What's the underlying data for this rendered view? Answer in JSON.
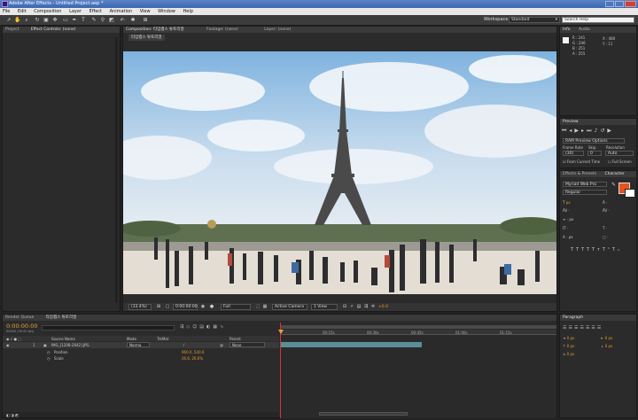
{
  "window": {
    "title": "Adobe After Effects - Untitled Project.aep *"
  },
  "menu": [
    "File",
    "Edit",
    "Composition",
    "Layer",
    "Effect",
    "Animation",
    "View",
    "Window",
    "Help"
  ],
  "toolbar": {
    "tools": [
      "selection-tool",
      "hand-tool",
      "zoom-tool",
      "rotate-tool",
      "camera-tool",
      "pan-behind-tool",
      "mask-tool",
      "pen-tool",
      "type-tool",
      "brush-tool",
      "clone-tool",
      "eraser-tool",
      "roto-brush-tool",
      "puppet-tool"
    ],
    "workspace_label": "Workspace:",
    "workspace_value": "Standard",
    "search_placeholder": "Search Help"
  },
  "project_panel": {
    "tab_project": "Project",
    "tab_effects": "Effect Controls: (none)"
  },
  "composition_panel": {
    "tab": "Composition: 타임랩스 튜토리얼",
    "tab_footage": "Footage: (none)",
    "tab_layer": "Layer: (none)",
    "comp_name": "타임랩스 튜토리얼",
    "zoom": "(33.4%)",
    "timecode": "0:00:00:00",
    "resolution": "Full",
    "camera": "Active Camera",
    "view": "1 View",
    "exposure": "+0.0"
  },
  "info_panel": {
    "tab": "Info",
    "tab_audio": "Audio",
    "r": "R : 241",
    "g": "G : 246",
    "b": "B : 251",
    "a": "A : 255",
    "x": "X : 480",
    "y": "Y : 11"
  },
  "preview_panel": {
    "tab": "Preview",
    "options": "RAM Preview Options",
    "frame_rate_label": "Frame Rate",
    "skip_label": "Skip",
    "resolution_label": "Resolution",
    "frame_rate": "(30)",
    "skip": "0",
    "resolution": "Auto",
    "from_current": "From Current Time",
    "full_screen": "Full Screen"
  },
  "character_panel": {
    "tab_effects": "Effects & Presets",
    "tab_character": "Character",
    "font": "Myriad Web Pro",
    "style": "Regular",
    "size": "px",
    "px1": "px",
    "px2": "px",
    "fill_color": "#e8531b"
  },
  "paragraph_panel": {
    "tab": "Paragraph",
    "px1": "0 px",
    "px2": "0 px",
    "px3": "0 px",
    "px4": "0 px",
    "px5": "0 px"
  },
  "timeline": {
    "tab_render": "Render Queue",
    "tab_comp": "타임랩스 튜토리얼",
    "timecode": "0:00:00:00",
    "frames": "00000 (30.00 fps)",
    "col_source": "Source Name",
    "col_mode": "Mode",
    "col_trkmat": "TrkMat",
    "col_parent": "Parent",
    "layer_num": "1",
    "layer_name": "IMG_[1208-2642].JPG",
    "layer_mode": "Norma",
    "layer_parent": "None",
    "prop_position": "Position",
    "prop_position_val": "960.0, 540.0",
    "prop_scale": "Scale",
    "prop_scale_val": "26.6, 26.6%",
    "ruler": [
      "00:15s",
      "00:30s",
      "00:45s",
      "01:00s",
      "01:15s"
    ]
  }
}
